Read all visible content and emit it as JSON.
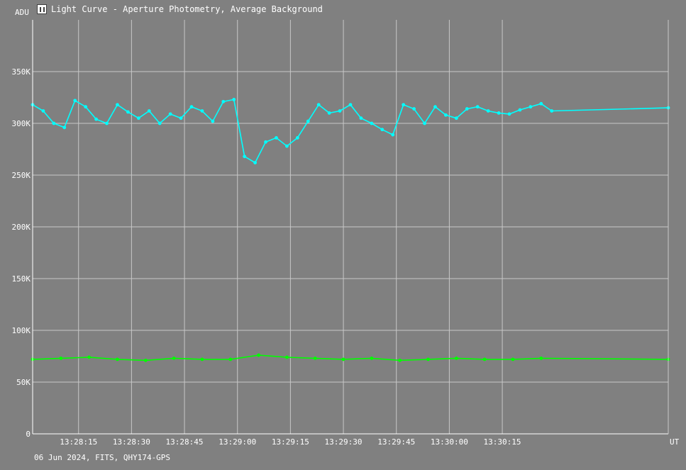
{
  "window": {
    "title": "Light Curve - Aperture Photometry, Average Background",
    "icon": "light-curve-app-icon"
  },
  "footer": {
    "note": "06 Jun 2024, FITS, QHY174-GPS"
  },
  "colors": {
    "background": "#808080",
    "grid": "#c8c8c8",
    "target": "#00ffff",
    "background_series": "#00ff00"
  },
  "chart_data": {
    "type": "line",
    "title": "Light Curve - Aperture Photometry, Average Background",
    "xlabel": "UT",
    "ylabel": "ADU",
    "xlim": [
      "13:28:02",
      "13:31:02"
    ],
    "ylim": [
      0,
      400000
    ],
    "x_ticks": [
      "13:28:15",
      "13:28:30",
      "13:28:45",
      "13:29:00",
      "13:29:15",
      "13:29:30",
      "13:29:45",
      "13:30:00",
      "13:30:15"
    ],
    "y_ticks": [
      {
        "value": 0,
        "label": "0"
      },
      {
        "value": 50000,
        "label": "50K"
      },
      {
        "value": 100000,
        "label": "100K"
      },
      {
        "value": 150000,
        "label": "150K"
      },
      {
        "value": 200000,
        "label": "200K"
      },
      {
        "value": 250000,
        "label": "250K"
      },
      {
        "value": 300000,
        "label": "300K"
      },
      {
        "value": 350000,
        "label": "350K"
      }
    ],
    "grid": true,
    "series": [
      {
        "color": "#00ffff",
        "x": [
          "13:28:02",
          "13:28:05",
          "13:28:08",
          "13:28:11",
          "13:28:14",
          "13:28:17",
          "13:28:20",
          "13:28:23",
          "13:28:26",
          "13:28:29",
          "13:28:32",
          "13:28:35",
          "13:28:38",
          "13:28:41",
          "13:28:44",
          "13:28:47",
          "13:28:50",
          "13:28:53",
          "13:28:56",
          "13:28:59",
          "13:29:02",
          "13:29:05",
          "13:29:08",
          "13:29:11",
          "13:29:14",
          "13:29:17",
          "13:29:20",
          "13:29:23",
          "13:29:26",
          "13:29:29",
          "13:29:32",
          "13:29:35",
          "13:29:38",
          "13:29:41",
          "13:29:44",
          "13:29:47",
          "13:29:50",
          "13:29:53",
          "13:29:56",
          "13:29:59",
          "13:30:02",
          "13:30:05",
          "13:30:08",
          "13:30:11",
          "13:30:14",
          "13:30:17",
          "13:30:20",
          "13:30:23",
          "13:30:26",
          "13:30:29",
          "13:31:02"
        ],
        "values": [
          318000,
          312000,
          300000,
          296000,
          322000,
          316000,
          304000,
          300000,
          318000,
          311000,
          305000,
          312000,
          300000,
          309000,
          305000,
          316000,
          312000,
          302000,
          321000,
          323000,
          268000,
          262000,
          282000,
          286000,
          278000,
          286000,
          302000,
          318000,
          310000,
          312000,
          318000,
          305000,
          300000,
          294000,
          289000,
          318000,
          314000,
          300000,
          316000,
          308000,
          305000,
          314000,
          316000,
          312000,
          310000,
          309000,
          313000,
          316000,
          319000,
          312000,
          315000
        ]
      },
      {
        "color": "#00ff00",
        "x": [
          "13:28:02",
          "13:28:10",
          "13:28:18",
          "13:28:26",
          "13:28:34",
          "13:28:42",
          "13:28:50",
          "13:28:58",
          "13:29:06",
          "13:29:14",
          "13:29:22",
          "13:29:30",
          "13:29:38",
          "13:29:46",
          "13:29:54",
          "13:30:02",
          "13:30:10",
          "13:30:18",
          "13:30:26",
          "13:31:02"
        ],
        "values": [
          72000,
          73000,
          74000,
          72000,
          71000,
          73000,
          72000,
          72000,
          76000,
          74000,
          73000,
          72000,
          73000,
          71000,
          72000,
          73000,
          72000,
          72000,
          73000,
          72000
        ]
      }
    ]
  }
}
